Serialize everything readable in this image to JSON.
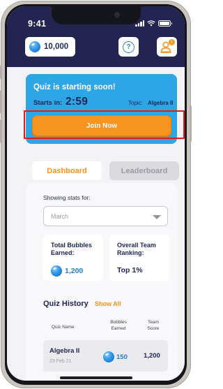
{
  "status_bar": {
    "time": "9:41"
  },
  "header": {
    "bubbles_count": "10,000",
    "help_icon": "question-mark-icon",
    "profile_icon": "person-badge-icon",
    "notification_badge": "!"
  },
  "quiz_banner": {
    "title": "Quiz is starting soon!",
    "starts_in_label": "Starts in:",
    "countdown": "2:59",
    "topic_label": "Topic:",
    "topic_value": "Algebra II",
    "join_label": "Join Now"
  },
  "tabs": {
    "dashboard": "Dashboard",
    "leaderboard": "Leaderboard",
    "active": "Dashboard"
  },
  "stats": {
    "showing_label": "Showing stats for:",
    "month_selected": "March",
    "total_title": "Total Bubbles Earned:",
    "total_value": "1,200",
    "ranking_title": "Overall Team Ranking:",
    "ranking_value": "Top 1%"
  },
  "quiz_history": {
    "title": "Quiz History",
    "show_all": "Show All",
    "columns": {
      "quiz_name": "Quiz Name",
      "bubbles_line1": "Bubbles",
      "bubbles_line2": "Earned",
      "team_line1": "Team",
      "team_line2": "Score"
    },
    "rows": [
      {
        "name": "Algebra II",
        "date": "23 Feb 21",
        "bubbles": "150",
        "team_score": "1,200"
      }
    ]
  },
  "colors": {
    "header_bg": "#232452",
    "banner_blue": "#2ea6e6",
    "accent_orange": "#f7931f",
    "highlight_red": "#e01c1c",
    "navy_text": "#1d2456"
  }
}
